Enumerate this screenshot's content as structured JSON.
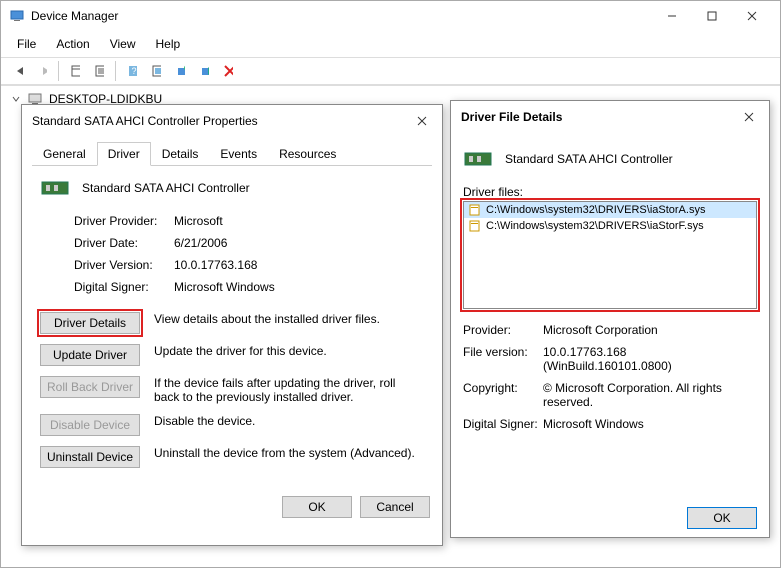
{
  "window": {
    "title": "Device Manager"
  },
  "menubar": [
    "File",
    "Action",
    "View",
    "Help"
  ],
  "tree": {
    "root": "DESKTOP-LDIDKBU"
  },
  "dialog1": {
    "title": "Standard SATA AHCI Controller Properties",
    "tabs": [
      "General",
      "Driver",
      "Details",
      "Events",
      "Resources"
    ],
    "device_name": "Standard SATA AHCI Controller",
    "rows": {
      "provider_label": "Driver Provider:",
      "provider_value": "Microsoft",
      "date_label": "Driver Date:",
      "date_value": "6/21/2006",
      "version_label": "Driver Version:",
      "version_value": "10.0.17763.168",
      "signer_label": "Digital Signer:",
      "signer_value": "Microsoft Windows"
    },
    "buttons": {
      "details": "Driver Details",
      "details_desc": "View details about the installed driver files.",
      "update": "Update Driver",
      "update_desc": "Update the driver for this device.",
      "rollback": "Roll Back Driver",
      "rollback_desc": "If the device fails after updating the driver, roll back to the previously installed driver.",
      "disable": "Disable Device",
      "disable_desc": "Disable the device.",
      "uninstall": "Uninstall Device",
      "uninstall_desc": "Uninstall the device from the system (Advanced)."
    },
    "ok": "OK",
    "cancel": "Cancel"
  },
  "dialog2": {
    "title": "Driver File Details",
    "device_name": "Standard SATA AHCI Controller",
    "files_label": "Driver files:",
    "files": [
      "C:\\Windows\\system32\\DRIVERS\\iaStorA.sys",
      "C:\\Windows\\system32\\DRIVERS\\iaStorF.sys"
    ],
    "provider_label": "Provider:",
    "provider_value": "Microsoft Corporation",
    "version_label": "File version:",
    "version_value": "10.0.17763.168 (WinBuild.160101.0800)",
    "copyright_label": "Copyright:",
    "copyright_value": "© Microsoft Corporation. All rights reserved.",
    "signer_label": "Digital Signer:",
    "signer_value": "Microsoft Windows",
    "ok": "OK"
  }
}
